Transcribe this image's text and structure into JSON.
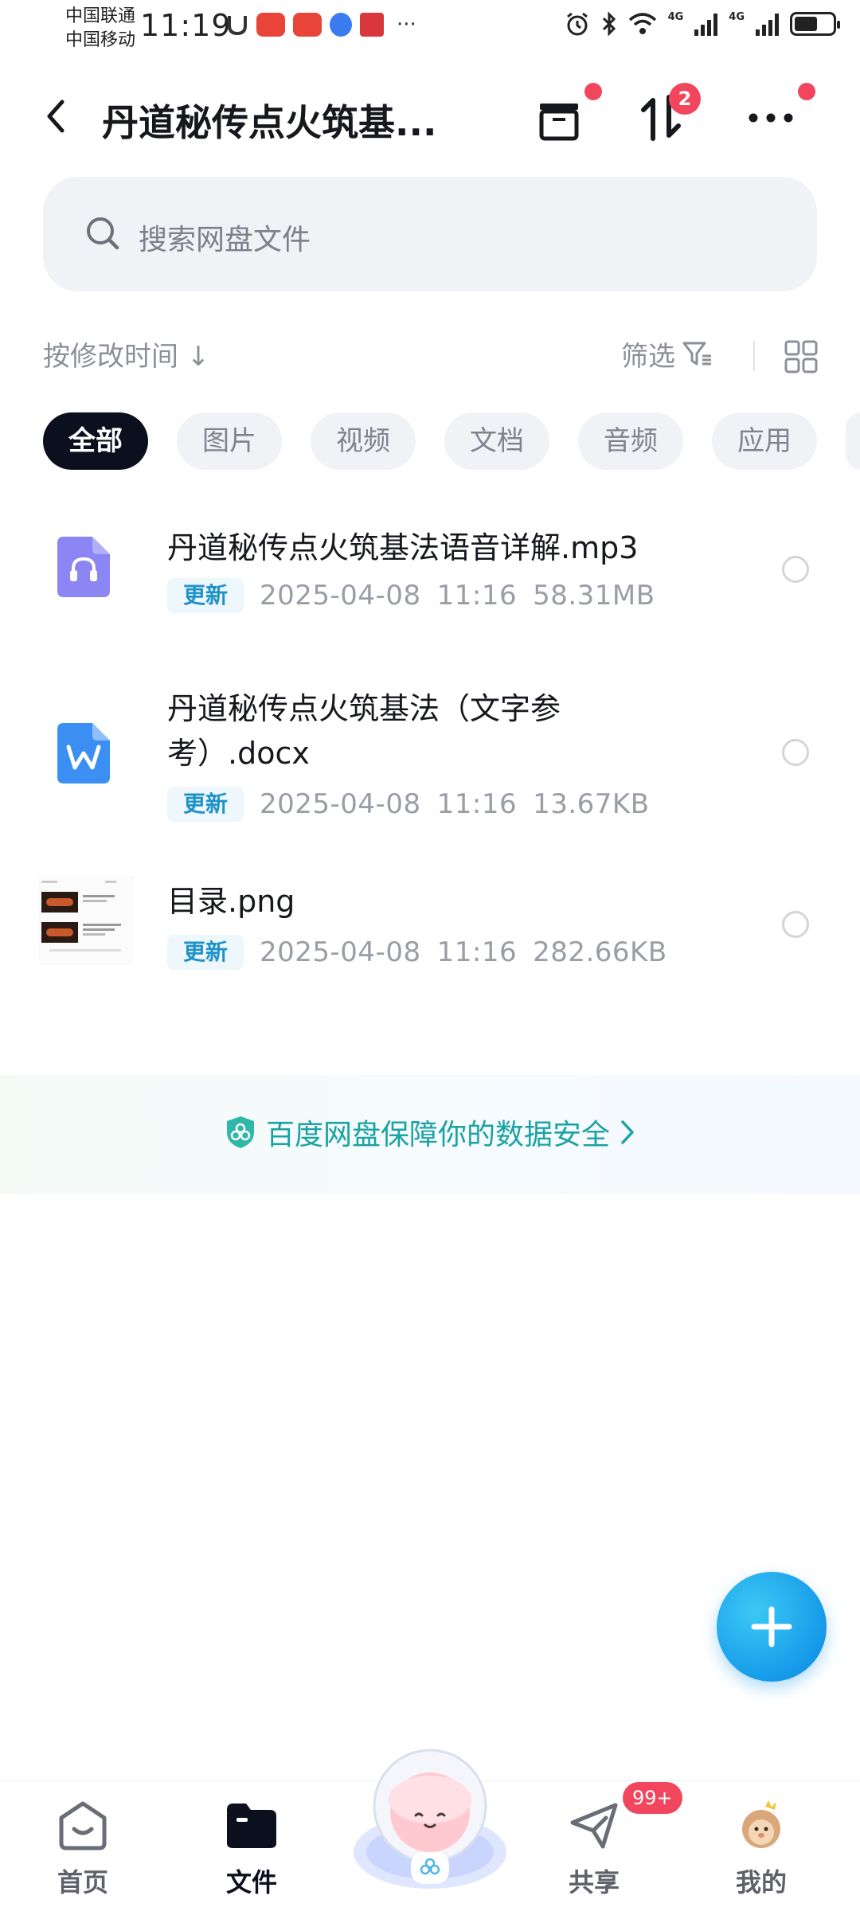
{
  "status_bar": {
    "carrier_1": "中国联通",
    "carrier_2": "中国移动",
    "time": "11:19",
    "network_1": "4G",
    "network_2": "4G",
    "battery_level": 0.6
  },
  "header": {
    "title": "丹道秘传点火筑基...",
    "transfer_badge_count": "2"
  },
  "search": {
    "placeholder": "搜索网盘文件"
  },
  "toolbar": {
    "sort_label": "按修改时间",
    "sort_arrow": "↓",
    "filter_label": "筛选"
  },
  "chips": [
    {
      "label": "全部",
      "active": true
    },
    {
      "label": "图片",
      "active": false
    },
    {
      "label": "视频",
      "active": false
    },
    {
      "label": "文档",
      "active": false
    },
    {
      "label": "音频",
      "active": false
    },
    {
      "label": "应用",
      "active": false
    }
  ],
  "files": [
    {
      "name": "丹道秘传点火筑基法语音详解.mp3",
      "tag": "更新",
      "date": "2025-04-08",
      "time": "11:16",
      "size": "58.31MB",
      "icon": "audio-file-icon"
    },
    {
      "name_line1": "丹道秘传点火筑基法（文字参",
      "name_line2": "考）.docx",
      "tag": "更新",
      "date": "2025-04-08",
      "time": "11:16",
      "size": "13.67KB",
      "icon": "word-file-icon"
    },
    {
      "name": "目录.png",
      "tag": "更新",
      "date": "2025-04-08",
      "time": "11:16",
      "size": "282.66KB",
      "icon": "image-thumbnail"
    }
  ],
  "banner": {
    "text": "百度网盘保障你的数据安全"
  },
  "bottom_nav": {
    "items": [
      {
        "label": "首页",
        "icon": "home-icon"
      },
      {
        "label": "文件",
        "icon": "folder-icon"
      },
      {
        "label": "共享",
        "icon": "send-icon"
      },
      {
        "label": "我的",
        "icon": "profile-avatar"
      }
    ],
    "share_badge": "99+"
  },
  "colors": {
    "accent_blue": "#169ae9",
    "tag_blue": "#1f93c7",
    "badge_red": "#f2455e",
    "banner_text": "#1ba3a3",
    "chip_active": "#0c0f1d"
  }
}
